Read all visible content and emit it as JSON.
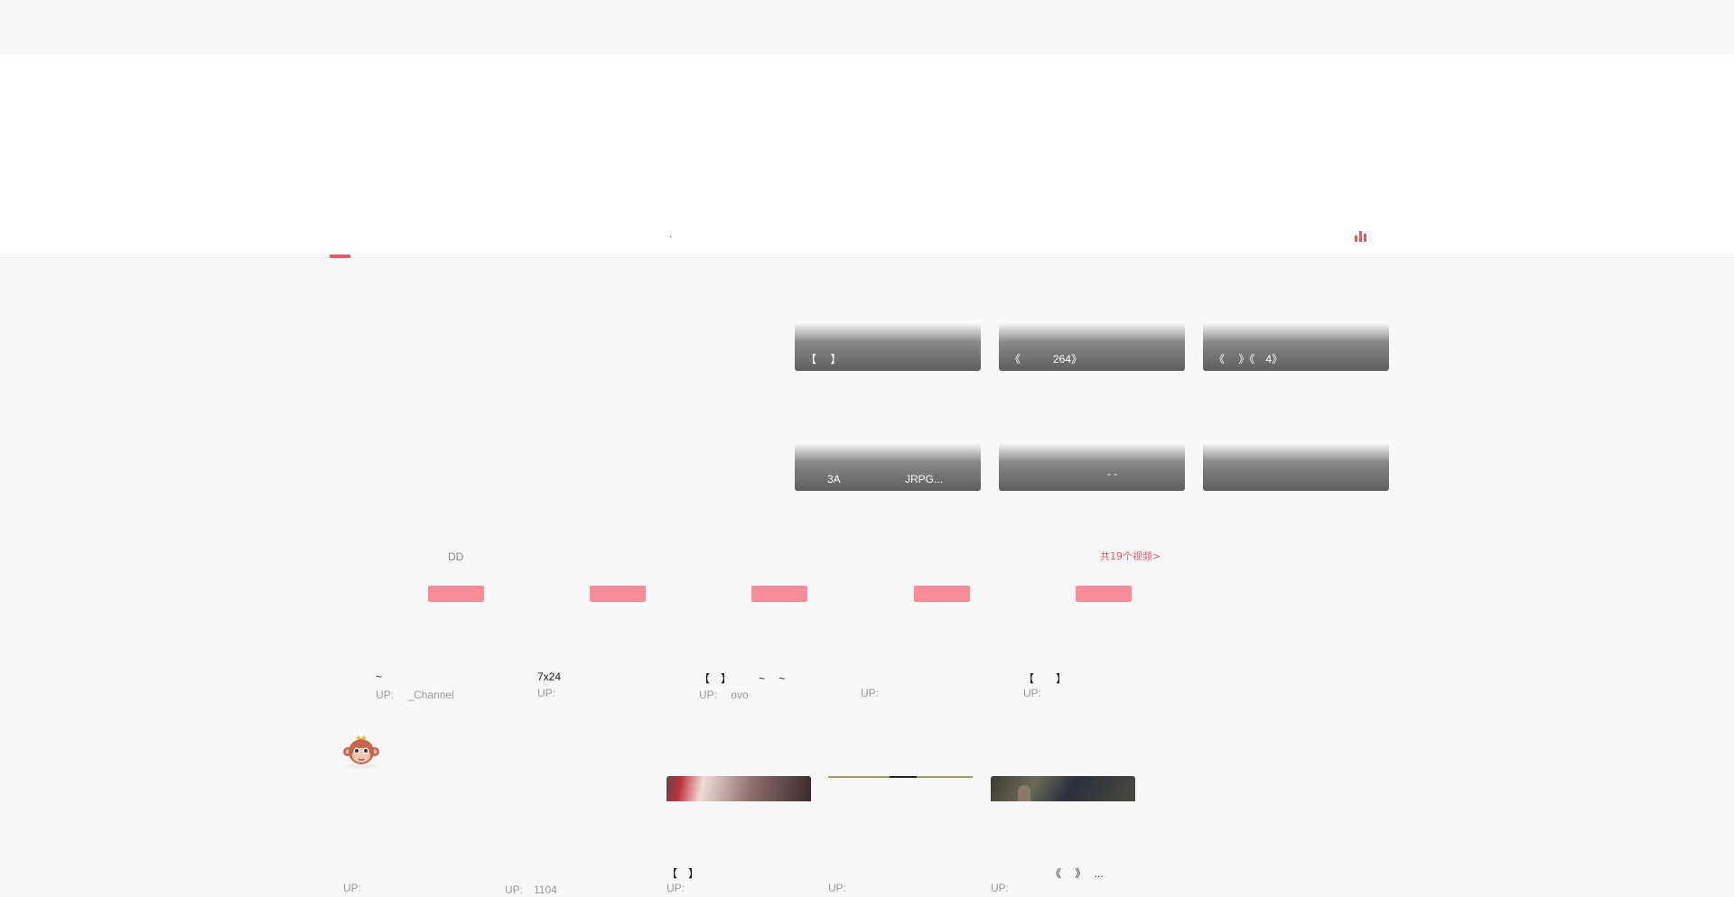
{
  "header": {
    "nav_dot": "."
  },
  "banner_cards": [
    {
      "title": "【　 】"
    },
    {
      "title": "《　　　264》"
    },
    {
      "title": "《　 》《　4》"
    },
    {
      "title": "　　3A　　　　　　JRPG..."
    },
    {
      "title": "　　　　　　　　　- -"
    },
    {
      "title": ""
    }
  ],
  "section": {
    "tab_label": "DD",
    "more_link": "共19个视频>",
    "more_color": "#e55a6a"
  },
  "row1": [
    {
      "title": "~",
      "up": "UP:　 _Channel"
    },
    {
      "title": "7x24",
      "up": "UP:"
    },
    {
      "title": "【　】　　　~　 ~",
      "up": "UP:　 ovo"
    },
    {
      "title": "",
      "up": "UP:"
    },
    {
      "title": "【　　】",
      "up": "UP:"
    }
  ],
  "row2": [
    {
      "title": "",
      "up": "UP:"
    },
    {
      "title": "",
      "up": "UP:　1104"
    },
    {
      "title": "【　】",
      "up": "UP:"
    },
    {
      "title": "",
      "up": "UP:"
    },
    {
      "title": "　　　　　　《　 》　 ...",
      "up": "UP:"
    }
  ],
  "colors": {
    "accent": "#e55a6a",
    "button": "#f88c98"
  },
  "icons": [
    "ranking-bar-icon",
    "monkey-mascot-icon"
  ]
}
